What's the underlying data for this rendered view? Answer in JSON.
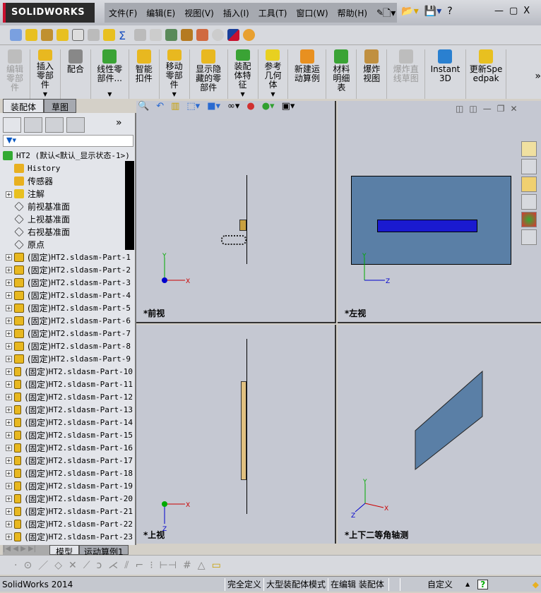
{
  "app": {
    "logo": "SOLIDWORKS"
  },
  "menu": [
    "文件(F)",
    "编辑(E)",
    "视图(V)",
    "插入(I)",
    "工具(T)",
    "窗口(W)",
    "帮助(H)"
  ],
  "window_controls": {
    "minimize": "—",
    "restore": "▢",
    "close": "X",
    "help": "?"
  },
  "command_manager": [
    {
      "label": "编辑零部件",
      "disabled": true,
      "color": "#bdbdbd"
    },
    {
      "label": "插入零部件",
      "dropdown": true,
      "color": "#e8b820"
    },
    {
      "label": "配合",
      "color": "#888888"
    },
    {
      "label": "线性零部件...",
      "dropdown": true,
      "color": "#3aa335"
    },
    {
      "label": "智能扣件",
      "color": "#e8b820"
    },
    {
      "label": "移动零部件",
      "dropdown": true,
      "color": "#e8b820"
    },
    {
      "label": "显示隐藏的零部件",
      "color": "#e8b820"
    },
    {
      "label": "装配体特征",
      "dropdown": true,
      "color": "#3aa335"
    },
    {
      "label": "参考几何体",
      "dropdown": true,
      "color": "#e8d020"
    },
    {
      "label": "新建运动算例",
      "color": "#e89020"
    },
    {
      "label": "材料明细表",
      "color": "#3aa335"
    },
    {
      "label": "爆炸视图",
      "color": "#c09040"
    },
    {
      "label": "爆炸直线草图",
      "disabled": true,
      "color": "#bdbdbd"
    },
    {
      "label": "Instant3D",
      "color": "#2a80d0"
    },
    {
      "label": "更新Speedpak",
      "color": "#e8c020"
    }
  ],
  "more": "»",
  "fm_tabs": [
    "装配体",
    "草图"
  ],
  "tree": {
    "root": "HT2  (默认<默认_显示状态-1>)",
    "items": [
      "History",
      "传感器",
      "注解",
      "前视基准面",
      "上视基准面",
      "右视基准面",
      "原点"
    ],
    "part_prefix": "(固定) ",
    "parts": [
      "HT2.sldasm-Part-1",
      "HT2.sldasm-Part-2",
      "HT2.sldasm-Part-3",
      "HT2.sldasm-Part-4",
      "HT2.sldasm-Part-5",
      "HT2.sldasm-Part-6",
      "HT2.sldasm-Part-7",
      "HT2.sldasm-Part-8",
      "HT2.sldasm-Part-9",
      "HT2.sldasm-Part-10",
      "HT2.sldasm-Part-11",
      "HT2.sldasm-Part-12",
      "HT2.sldasm-Part-13",
      "HT2.sldasm-Part-14",
      "HT2.sldasm-Part-15",
      "HT2.sldasm-Part-16",
      "HT2.sldasm-Part-17",
      "HT2.sldasm-Part-18",
      "HT2.sldasm-Part-19",
      "HT2.sldasm-Part-20",
      "HT2.sldasm-Part-21",
      "HT2.sldasm-Part-22",
      "HT2.sldasm-Part-23"
    ]
  },
  "bottom_tabs": [
    "模型",
    "运动算例1"
  ],
  "views": {
    "front": "*前视",
    "left": "*左视",
    "top": "*上视",
    "iso": "*上下二等角轴测"
  },
  "axes": {
    "x": "X",
    "y": "Y",
    "z": "Z"
  },
  "status": {
    "app": "SolidWorks 2014",
    "s1": "完全定义",
    "s2": "大型装配体模式",
    "s3": "在编辑 装配体",
    "units": "自定义",
    "help": "?"
  }
}
